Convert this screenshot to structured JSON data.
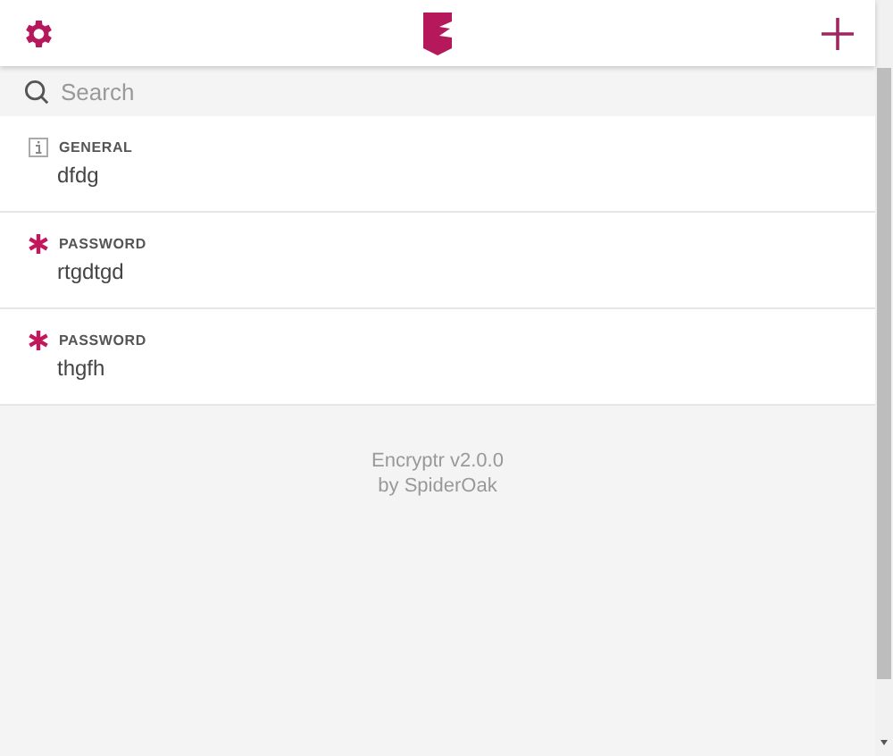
{
  "search": {
    "placeholder": "Search"
  },
  "entries": [
    {
      "kind": "general",
      "type_label": "GENERAL",
      "name": "dfdg"
    },
    {
      "kind": "password",
      "type_label": "PASSWORD",
      "name": "rtgdtgd"
    },
    {
      "kind": "password",
      "type_label": "PASSWORD",
      "name": "thgfh"
    }
  ],
  "footer": [
    "Encryptr v2.0.0",
    "by SpiderOak"
  ]
}
